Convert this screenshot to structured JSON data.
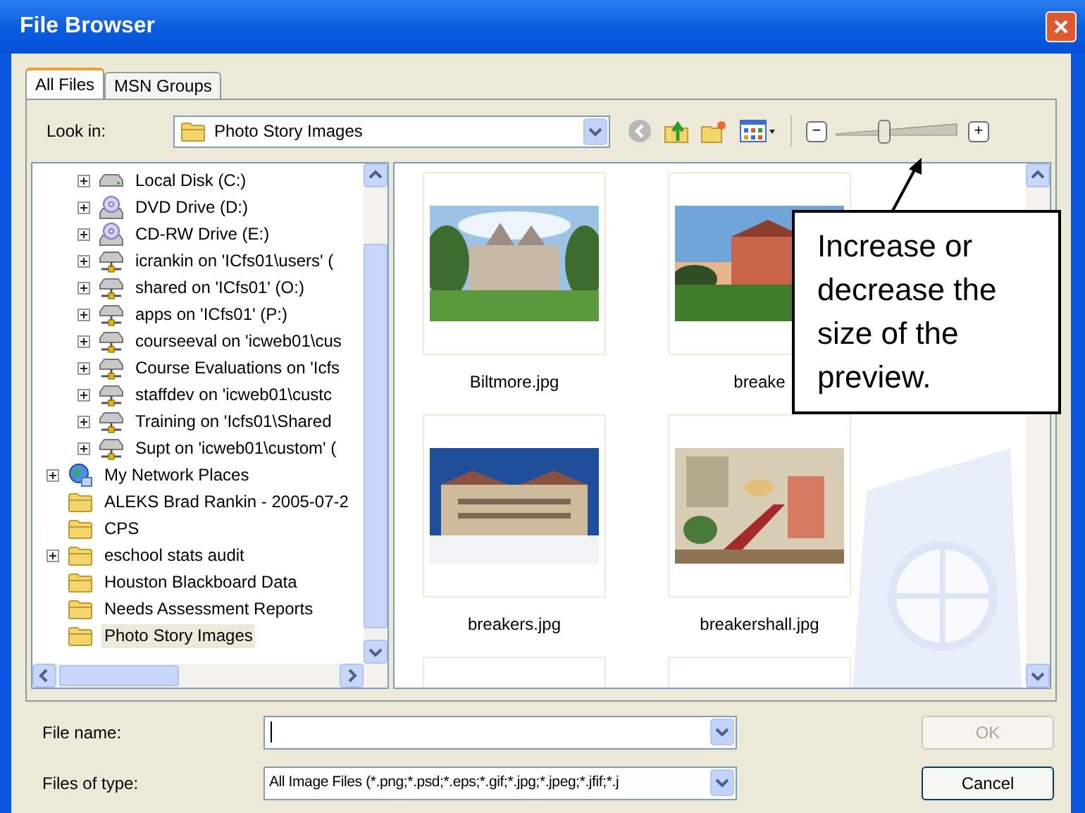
{
  "window": {
    "title": "File Browser"
  },
  "tabs": [
    {
      "label": "All Files",
      "selected": true
    },
    {
      "label": "MSN Groups",
      "selected": false
    }
  ],
  "look_in": {
    "label": "Look in:",
    "value": "Photo Story Images"
  },
  "zoom_slider": {
    "minus": "−",
    "plus": "+",
    "level": 0.38
  },
  "tree": {
    "nested_items": [
      {
        "label": "Local Disk (C:)",
        "kind": "disk",
        "expandable": true,
        "selected": false
      },
      {
        "label": "DVD Drive (D:)",
        "kind": "optical",
        "expandable": true,
        "selected": false
      },
      {
        "label": "CD-RW Drive (E:)",
        "kind": "optical",
        "expandable": true,
        "selected": false
      },
      {
        "label": "icrankin on 'ICfs01\\users' (",
        "kind": "netdrive",
        "expandable": true,
        "selected": false
      },
      {
        "label": "shared on 'ICfs01' (O:)",
        "kind": "netdrive",
        "expandable": true,
        "selected": false
      },
      {
        "label": "apps on 'ICfs01' (P:)",
        "kind": "netdrive",
        "expandable": true,
        "selected": false
      },
      {
        "label": "courseeval on 'icweb01\\cus",
        "kind": "netdrive",
        "expandable": true,
        "selected": false
      },
      {
        "label": "Course Evaluations on 'Icfs",
        "kind": "netdrive",
        "expandable": true,
        "selected": false
      },
      {
        "label": "staffdev on 'icweb01\\custc",
        "kind": "netdrive",
        "expandable": true,
        "selected": false
      },
      {
        "label": "Training on 'Icfs01\\Shared",
        "kind": "netdrive",
        "expandable": true,
        "selected": false
      },
      {
        "label": "Supt on 'icweb01\\custom' (",
        "kind": "netdrive",
        "expandable": true,
        "selected": false
      }
    ],
    "items": [
      {
        "label": "My Network Places",
        "kind": "network",
        "expandable": true,
        "selected": false
      },
      {
        "label": "ALEKS Brad Rankin - 2005-07-2",
        "kind": "folder",
        "expandable": false,
        "selected": false
      },
      {
        "label": "CPS",
        "kind": "folder",
        "expandable": false,
        "selected": false
      },
      {
        "label": "eschool stats audit",
        "kind": "folder",
        "expandable": true,
        "selected": false
      },
      {
        "label": "Houston Blackboard Data",
        "kind": "folder",
        "expandable": false,
        "selected": false
      },
      {
        "label": "Needs Assessment Reports",
        "kind": "folder",
        "expandable": false,
        "selected": false
      },
      {
        "label": "Photo Story Images",
        "kind": "folder",
        "expandable": false,
        "selected": true
      }
    ]
  },
  "thumbnails": [
    {
      "label": "Biltmore.jpg",
      "kind": "picture"
    },
    {
      "label": "breake",
      "kind": "picture"
    },
    {
      "label": "breakers.jpg",
      "kind": "picture"
    },
    {
      "label": "breakershall.jpg",
      "kind": "picture"
    },
    {
      "kind": "empty"
    },
    {
      "kind": "empty"
    }
  ],
  "callout": {
    "text": "Increase or decrease the size of the preview."
  },
  "file_name": {
    "label": "File name:"
  },
  "file_type": {
    "label": "Files of type:",
    "value": "All Image Files (*.png;*.psd;*.eps;*.gif;*.jpg;*.jpeg;*.jfif;*.j"
  },
  "buttons": [
    {
      "label": "OK",
      "disabled": true
    },
    {
      "label": "Cancel",
      "disabled": false
    }
  ]
}
